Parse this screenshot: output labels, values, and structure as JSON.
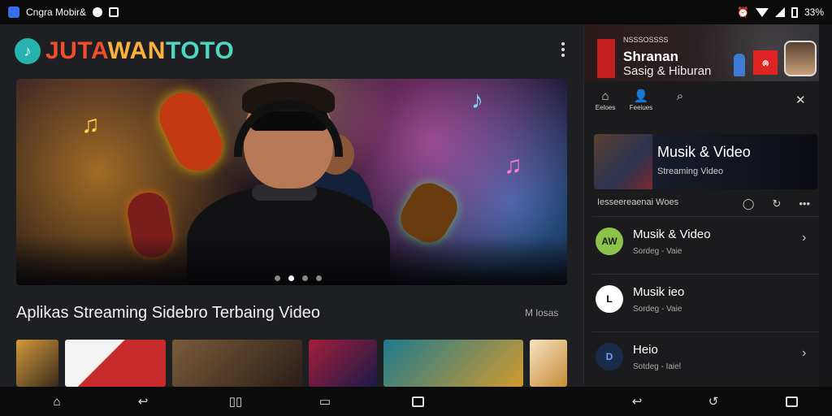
{
  "status_bar": {
    "app_name": "Cngra Mobir&",
    "battery": "33%",
    "icons": [
      "app-icon",
      "circle-icon",
      "image-icon",
      "alarm-icon",
      "wifi-icon",
      "signal-icon",
      "battery-icon"
    ]
  },
  "brand": {
    "logo_segments": [
      "JUTA",
      "WAN",
      "TOTO"
    ],
    "logo_icon": "music-note-icon",
    "colors": {
      "red": "#f04e29",
      "yellow": "#fbb13c",
      "teal": "#4fd6c3"
    }
  },
  "hero": {
    "carousel_dots": 4,
    "active_dot": 1
  },
  "section": {
    "title": "Aplikas Streaming Sidebro Terbaing Video",
    "more": "M losas"
  },
  "panel": {
    "tiny_text": "NSSSOSSSS",
    "title": "Shranan",
    "subtitle": "Sasig & Hiburan",
    "red_logo": "ၐ",
    "nav": [
      {
        "icon": "home-icon",
        "label": "Eeloes"
      },
      {
        "icon": "person-icon",
        "label": "Feeiues"
      },
      {
        "icon": "search-icon",
        "label": ""
      }
    ],
    "close_icon": "close-icon",
    "card": {
      "title": "Musik & Video",
      "subtitle": "Streaming Video"
    },
    "meta_text": "Iesseereaenai Woes",
    "items": [
      {
        "title": "Musik & Video",
        "subtitle": "Sordeg - Vaie",
        "avatar": "AW",
        "avatar_bg": "#8bc34a",
        "avatar_color": "#1a1a1a",
        "chevron": true
      },
      {
        "title": "Musik ieo",
        "subtitle": "Sordeg - Vaie",
        "avatar": "L",
        "avatar_bg": "#ffffff",
        "avatar_color": "#000000",
        "chevron": false
      },
      {
        "title": "Heio",
        "subtitle": "Sotdeg - Iaiel",
        "avatar": "D",
        "avatar_bg": "#1a2a4a",
        "avatar_color": "#6aa0ff",
        "chevron": true
      }
    ]
  },
  "bottom_nav": {
    "left": [
      "home-icon",
      "back-icon",
      "book-icon",
      "tv-icon",
      "square-icon"
    ],
    "right": [
      "back-icon",
      "undo-icon",
      "square-icon"
    ]
  }
}
